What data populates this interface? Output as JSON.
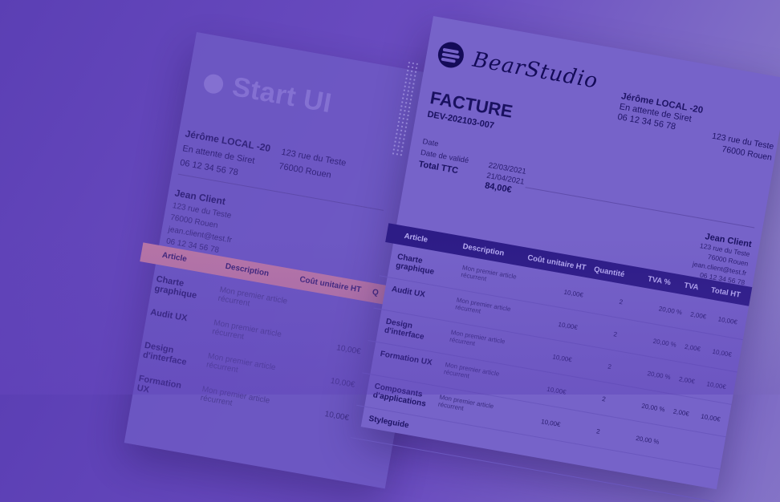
{
  "back_doc": {
    "brand": "Start UI",
    "sender": {
      "name": "Jérôme LOCAL -20",
      "status": "En attente de Siret",
      "phone": "06 12 34 56 78"
    },
    "address": {
      "street": "123 rue du Teste",
      "city": "76000 Rouen"
    },
    "client": {
      "name": "Jean Client",
      "street": "123 rue du Teste",
      "city": "76000 Rouen",
      "email": "jean.client@test.fr",
      "phone": "06 12 34 56 78"
    },
    "headers": [
      "Article",
      "Description",
      "Coût unitaire HT",
      "Q"
    ],
    "rows": [
      {
        "article": "Charte graphique",
        "description": "Mon premier article récurrent",
        "price": ""
      },
      {
        "article": "Audit UX",
        "description": "Mon premier article récurrent",
        "price": "10,00€"
      },
      {
        "article": "Design d'interface",
        "description": "Mon premier article récurrent",
        "price": "10,00€"
      },
      {
        "article": "Formation UX",
        "description": "Mon premier article récurrent",
        "price": "10,00€"
      }
    ]
  },
  "front_doc": {
    "brand": "BearStudio",
    "title": "FACTURE",
    "number": "DEV-202103-007",
    "sender": {
      "name": "Jérôme LOCAL -20",
      "status": "En attente de Siret",
      "phone": "06 12 34 56 78"
    },
    "address": {
      "street": "123 rue du Teste",
      "city": "76000 Rouen"
    },
    "meta": {
      "date_label": "Date",
      "validity_label": "Date de validé",
      "total_label": "Total TTC",
      "date": "22/03/2021",
      "validity": "21/04/2021",
      "total": "84,00€"
    },
    "client": {
      "name": "Jean Client",
      "street": "123 rue du Teste",
      "city": "76000 Rouen",
      "email": "jean.client@test.fr",
      "phone": "06 12 34 56 78"
    },
    "headers": [
      "Article",
      "Description",
      "Coût unitaire HT",
      "Quantité",
      "TVA %",
      "TVA",
      "Total HT"
    ],
    "rows": [
      {
        "article": "Charte graphique",
        "description": "Mon premier article récurrent",
        "price": "10,00€",
        "qty": "2",
        "vat_pct": "20,00 %",
        "vat": "2,00€",
        "total": "10,00€"
      },
      {
        "article": "Audit UX",
        "description": "Mon premier article récurrent",
        "price": "10,00€",
        "qty": "2",
        "vat_pct": "20,00 %",
        "vat": "2,00€",
        "total": "10,00€"
      },
      {
        "article": "Design d'interface",
        "description": "Mon premier article récurrent",
        "price": "10,00€",
        "qty": "2",
        "vat_pct": "20,00 %",
        "vat": "2,00€",
        "total": "10,00€"
      },
      {
        "article": "Formation UX",
        "description": "Mon premier article récurrent",
        "price": "10,00€",
        "qty": "2",
        "vat_pct": "20,00 %",
        "vat": "2,00€",
        "total": "10,00€"
      },
      {
        "article": "Composants d'applications",
        "description": "Mon premier article récurrent",
        "price": "10,00€",
        "qty": "2",
        "vat_pct": "20,00 %",
        "vat": "",
        "total": ""
      },
      {
        "article": "Styleguide",
        "description": "",
        "price": "",
        "qty": "",
        "vat_pct": "",
        "vat": "",
        "total": ""
      }
    ]
  }
}
